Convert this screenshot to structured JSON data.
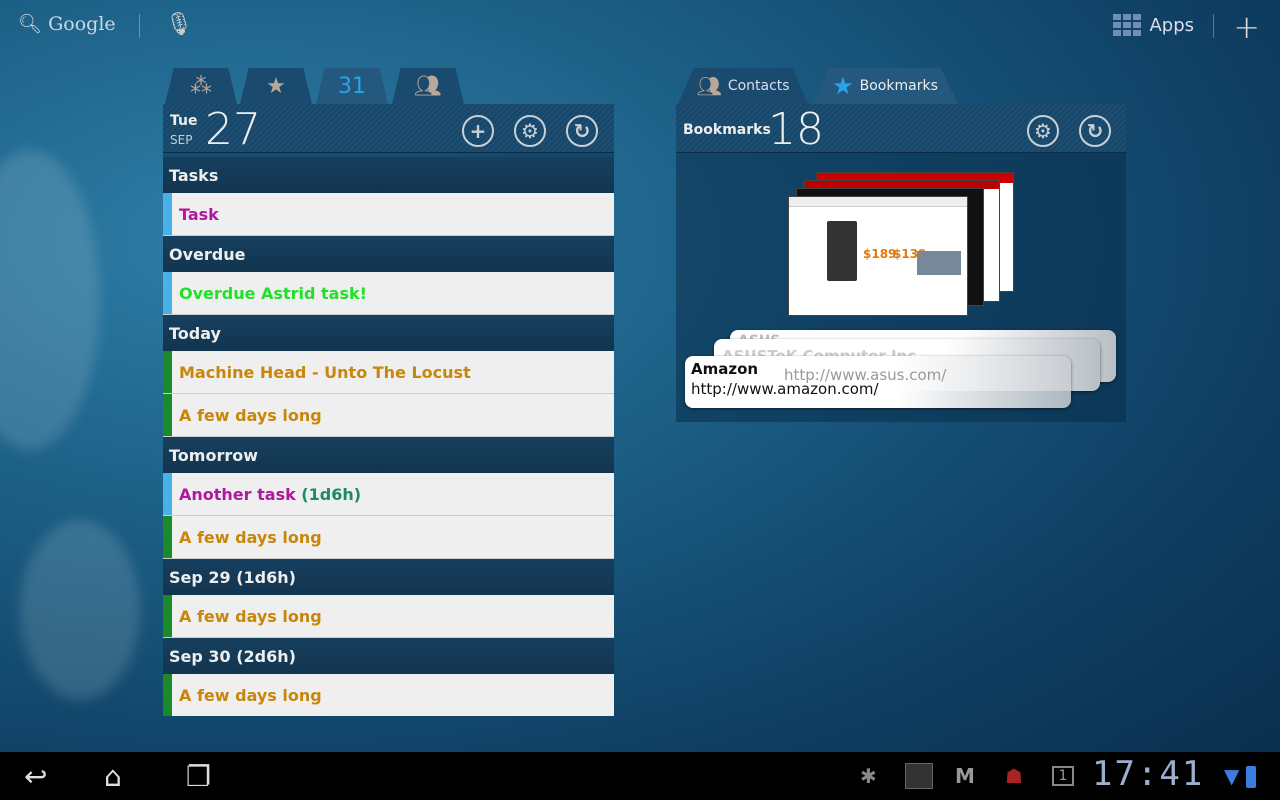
{
  "topbar": {
    "search_label": "Google",
    "apps_label": "Apps"
  },
  "calendar_widget": {
    "tabs": [
      {
        "icon": "circles-icon"
      },
      {
        "icon": "star-icon"
      },
      {
        "label": "31",
        "active": true
      },
      {
        "icon": "people-icon"
      }
    ],
    "day": "Tue",
    "month": "SEP",
    "date": "27",
    "sections": [
      {
        "title": "Tasks",
        "rows": [
          {
            "text": "Task",
            "color": "#b0179f",
            "bar": "#4ab0e8"
          }
        ]
      },
      {
        "title": "Overdue",
        "rows": [
          {
            "text": "Overdue Astrid task!",
            "color": "#22e02a",
            "bar": "#4ab0e8"
          }
        ]
      },
      {
        "title": "Today",
        "rows": [
          {
            "text": "Machine Head - Unto The Locust",
            "color": "#c8860a",
            "bar": "#1a8a2a"
          },
          {
            "text": "A few days long",
            "color": "#c8860a",
            "bar": "#1a8a2a"
          }
        ]
      },
      {
        "title": "Tomorrow",
        "rows": [
          {
            "text": "Another task",
            "suffix": " (1d6h)",
            "color": "#b0179f",
            "suffix_color": "#1a8a6a",
            "bar": "#4ab0e8"
          },
          {
            "text": "A few days long",
            "color": "#c8860a",
            "bar": "#1a8a2a"
          }
        ]
      },
      {
        "title": "Sep 29 (1d6h)",
        "rows": [
          {
            "text": "A few days long",
            "color": "#c8860a",
            "bar": "#1a8a2a"
          }
        ]
      },
      {
        "title": "Sep 30 (2d6h)",
        "rows": [
          {
            "text": "A few days long",
            "color": "#c8860a",
            "bar": "#1a8a2a"
          }
        ]
      }
    ]
  },
  "bookmarks_widget": {
    "tabs": [
      {
        "label": "Contacts"
      },
      {
        "label": "Bookmarks",
        "active": true
      }
    ],
    "title": "Bookmarks",
    "count": "18",
    "cards": [
      {
        "title": "ASUS",
        "url": ""
      },
      {
        "title": "ASUSTeK Computer Inc.",
        "url": "http://www.asus.com/"
      },
      {
        "title": "Amazon",
        "url": "http://www.amazon.com/"
      }
    ],
    "thumb_prices": [
      "$189",
      "$139"
    ]
  },
  "statusbar": {
    "time": "17:41"
  }
}
